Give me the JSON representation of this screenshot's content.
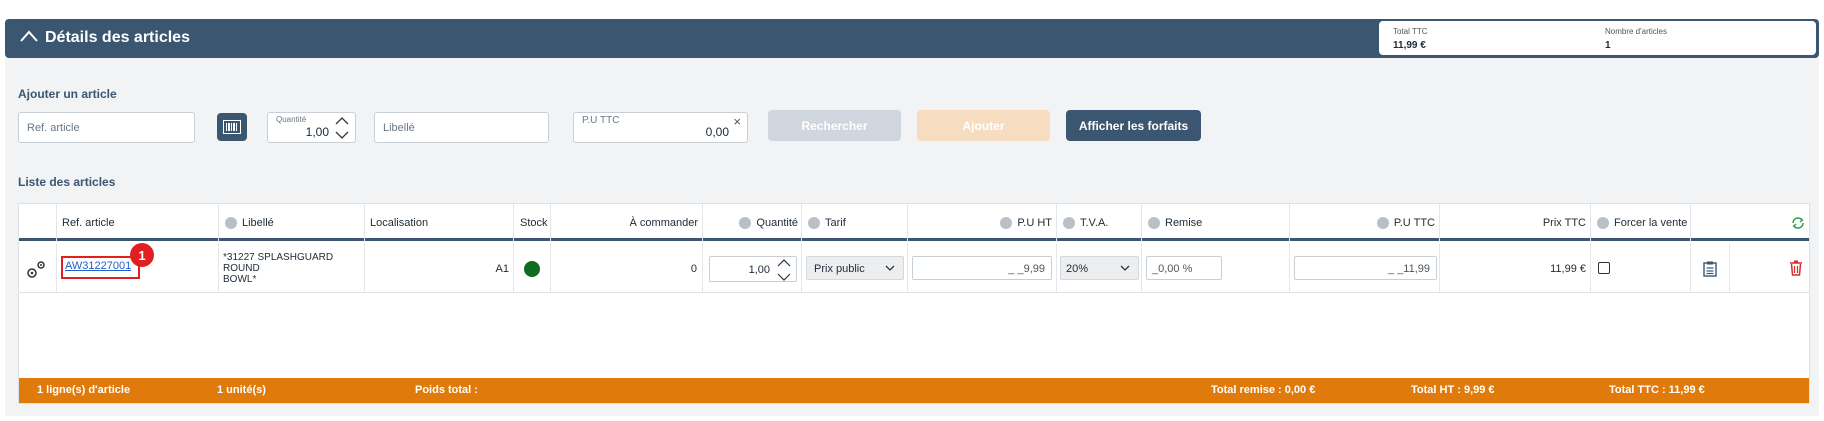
{
  "header": {
    "title": "Détails des articles",
    "total_ttc_label": "Total TTC",
    "total_ttc_value": "11,99 €",
    "nb_articles_label": "Nombre d'articles",
    "nb_articles_value": "1"
  },
  "add_article": {
    "section_title": "Ajouter un article",
    "ref_placeholder": "Ref. article",
    "quantity_label": "Quantité",
    "quantity_value": "1,00",
    "libelle_placeholder": "Libellé",
    "pu_ttc_label": "P.U TTC",
    "pu_ttc_value": "0,00",
    "clear_glyph": "×",
    "search_button": "Rechercher",
    "add_button": "Ajouter",
    "forfaits_button": "Afficher les forfaits"
  },
  "list": {
    "section_title": "Liste des articles",
    "columns": {
      "ref": "Ref. article",
      "libelle": "Libellé",
      "localisation": "Localisation",
      "stock": "Stock",
      "a_commander": "À commander",
      "quantite": "Quantité",
      "tarif": "Tarif",
      "pu_ht": "P.U HT",
      "tva": "T.V.A.",
      "remise": "Remise",
      "pu_ttc": "P.U TTC",
      "prix_ttc": "Prix TTC",
      "forcer": "Forcer la vente"
    },
    "rows": [
      {
        "ref": "AW31227001",
        "badge": "1",
        "libelle_line1": "*31227 SPLASHGUARD ROUND",
        "libelle_line2": "BOWL*",
        "localisation": "A1",
        "stock_color": "#0e6b1f",
        "a_commander": "0",
        "quantite": "1,00",
        "tarif": "Prix public",
        "pu_ht": "_ _9,99",
        "tva": "20%",
        "remise": "_0,00 %",
        "pu_ttc": "_ _11,99",
        "prix_ttc": "11,99 €"
      }
    ]
  },
  "footer": {
    "lignes": "1 ligne(s) d'article",
    "unites": "1 unité(s)",
    "poids": "Poids total :",
    "total_remise": "Total remise : 0,00 €",
    "total_ht": "Total HT : 9,99 €",
    "total_ttc": "Total TTC : 11,99 €"
  },
  "colors": {
    "header_bg": "#3a5671",
    "footer_bg": "#e07b0b",
    "delete_red": "#d32f2f",
    "refresh_green": "#2e9e44"
  }
}
